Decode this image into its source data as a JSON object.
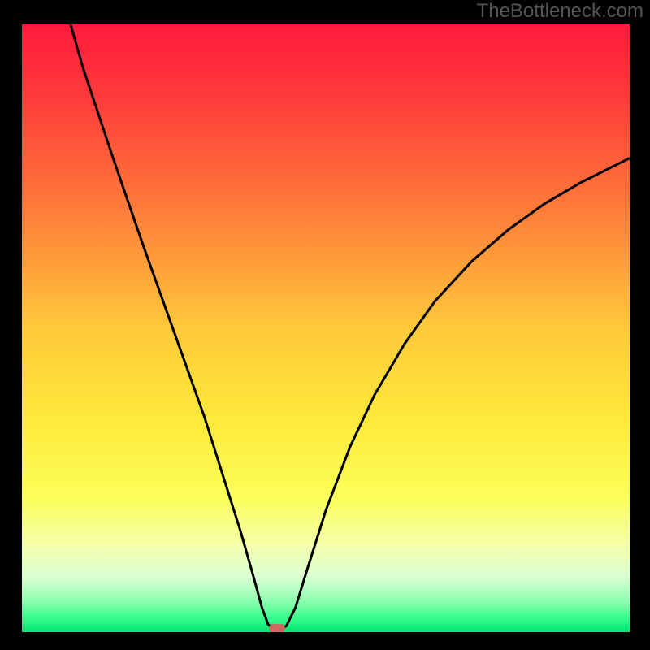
{
  "attribution": "TheBottleneck.com",
  "chart_data": {
    "type": "line",
    "title": "",
    "xlabel": "",
    "ylabel": "",
    "xlim": [
      0,
      100
    ],
    "ylim": [
      0,
      100
    ],
    "gradient": {
      "type": "vertical",
      "stops": [
        {
          "pos": 0.0,
          "color": "#ff1a3d"
        },
        {
          "pos": 0.12,
          "color": "#ff3b3b"
        },
        {
          "pos": 0.3,
          "color": "#ff7a3a"
        },
        {
          "pos": 0.5,
          "color": "#ffc93a"
        },
        {
          "pos": 0.65,
          "color": "#ffe93a"
        },
        {
          "pos": 0.78,
          "color": "#fbff5a"
        },
        {
          "pos": 0.86,
          "color": "#f3ffb0"
        },
        {
          "pos": 0.91,
          "color": "#d9ffd0"
        },
        {
          "pos": 0.95,
          "color": "#8bffb0"
        },
        {
          "pos": 0.975,
          "color": "#3bff8c"
        },
        {
          "pos": 1.0,
          "color": "#00e676"
        }
      ]
    },
    "series": [
      {
        "name": "curve",
        "color": "#000000",
        "stroke_width": 3,
        "points": [
          {
            "x": 8.0,
            "y": 100.0
          },
          {
            "x": 10.0,
            "y": 93.0
          },
          {
            "x": 15.0,
            "y": 78.0
          },
          {
            "x": 20.0,
            "y": 63.5
          },
          {
            "x": 25.0,
            "y": 49.5
          },
          {
            "x": 30.0,
            "y": 35.5
          },
          {
            "x": 33.0,
            "y": 26.0
          },
          {
            "x": 36.0,
            "y": 16.5
          },
          {
            "x": 38.0,
            "y": 9.5
          },
          {
            "x": 39.5,
            "y": 4.0
          },
          {
            "x": 40.5,
            "y": 1.3
          },
          {
            "x": 41.3,
            "y": 0.5
          },
          {
            "x": 42.5,
            "y": 0.4
          },
          {
            "x": 43.5,
            "y": 1.0
          },
          {
            "x": 45.0,
            "y": 4.0
          },
          {
            "x": 47.0,
            "y": 10.5
          },
          {
            "x": 50.0,
            "y": 20.0
          },
          {
            "x": 54.0,
            "y": 30.5
          },
          {
            "x": 58.0,
            "y": 39.0
          },
          {
            "x": 63.0,
            "y": 47.5
          },
          {
            "x": 68.0,
            "y": 54.5
          },
          {
            "x": 74.0,
            "y": 61.0
          },
          {
            "x": 80.0,
            "y": 66.2
          },
          {
            "x": 86.0,
            "y": 70.5
          },
          {
            "x": 92.0,
            "y": 74.0
          },
          {
            "x": 98.0,
            "y": 77.0
          },
          {
            "x": 100.0,
            "y": 78.0
          }
        ]
      }
    ],
    "marker": {
      "name": "min-point",
      "x": 42.0,
      "y": 0.6,
      "width_pct": 2.6,
      "height_pct": 1.6,
      "color": "#cc6a5f"
    }
  }
}
